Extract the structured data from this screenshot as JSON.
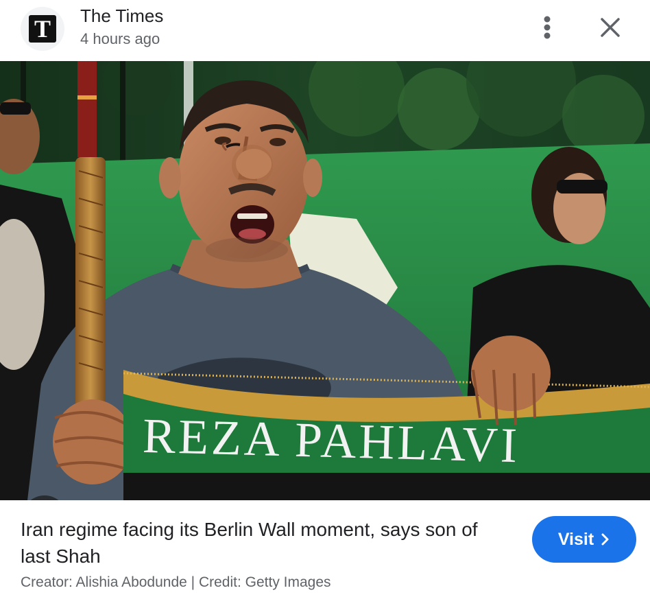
{
  "header": {
    "logo_letter": "T",
    "source_name": "The Times",
    "timestamp": "4 hours ago",
    "more_icon": "more-vert-icon",
    "close_icon": "close-icon"
  },
  "image": {
    "banner_text": "REZA PAHLAVI",
    "lens_icon": "google-lens-icon"
  },
  "result": {
    "title": "Iran regime facing its Berlin Wall moment, says son of last Shah",
    "credit": "Creator: Alishia Abodunde | Credit: Getty Images",
    "visit_label": "Visit",
    "visit_icon": "chevron-right-icon"
  },
  "colors": {
    "accent": "#1a73e8",
    "banner_green": "#1e7a3a",
    "fringe_gold": "#c99a3a",
    "shirt": "#4a5867"
  }
}
